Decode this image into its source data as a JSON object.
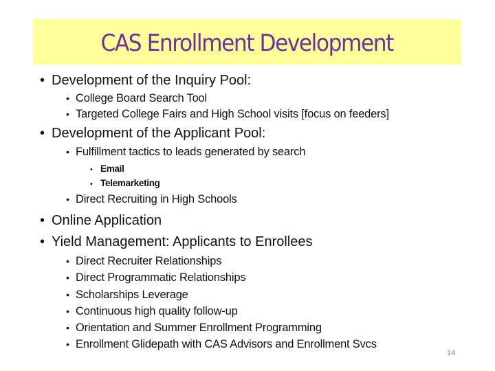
{
  "slide": {
    "title": "CAS Enrollment Development",
    "colors": {
      "title_background": "#ffff99",
      "title_text": "#7030a0",
      "body_text": "#111111",
      "page_number": "#888888"
    },
    "bullet_glyph": "•",
    "sections": [
      {
        "label": "Development of the Inquiry Pool:",
        "items": [
          {
            "label": "College Board Search Tool"
          },
          {
            "label": "Targeted College Fairs and High School visits [focus on feeders]"
          }
        ]
      },
      {
        "label": "Development of the Applicant Pool:",
        "items": [
          {
            "label": "Fulfillment tactics to leads generated by search",
            "subitems": [
              "Email",
              "Telemarketing"
            ]
          },
          {
            "label": "Direct Recruiting in High Schools"
          }
        ]
      },
      {
        "label": "Online Application",
        "items": []
      },
      {
        "label": "Yield Management:  Applicants to Enrollees",
        "items": [
          {
            "label": "Direct Recruiter Relationships"
          },
          {
            "label": "Direct Programmatic Relationships"
          },
          {
            "label": "Scholarships Leverage"
          },
          {
            "label": "Continuous high quality follow-up"
          },
          {
            "label": "Orientation and Summer Enrollment Programming"
          },
          {
            "label": "Enrollment Glidepath with CAS Advisors and Enrollment Svcs"
          }
        ]
      }
    ],
    "page_number": "14"
  }
}
